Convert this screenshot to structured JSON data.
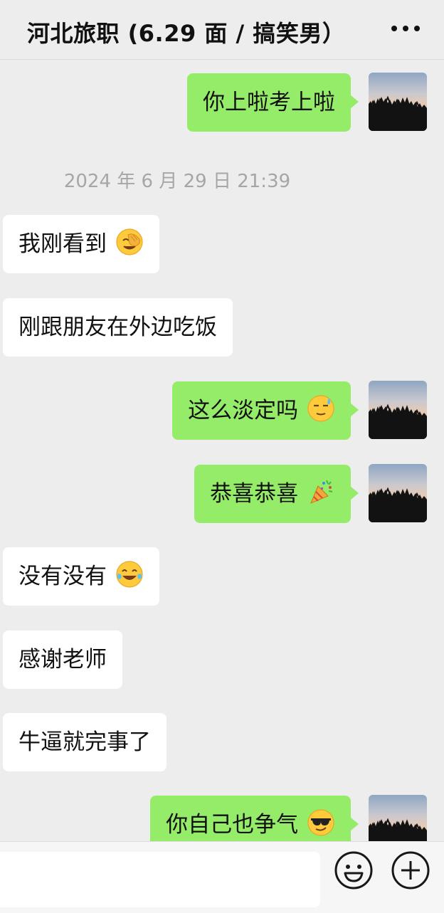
{
  "header": {
    "title": "河北旅职 (6.29 面 / 搞笑男）",
    "more_icon": "more-dots-icon"
  },
  "messages": [
    {
      "side": "out",
      "text": "你上啦考上啦"
    },
    {
      "type": "timestamp",
      "text": "2024 年 6 月 29 日 21:39"
    },
    {
      "side": "in",
      "text": "我刚看到",
      "emoji": "facepalm-emoji"
    },
    {
      "side": "in",
      "text": "刚跟朋友在外边吃饭"
    },
    {
      "side": "out",
      "text": "这么淡定吗",
      "emoji": "sweat-smile-emoji"
    },
    {
      "side": "out",
      "text": "恭喜恭喜",
      "emoji": "party-popper-emoji"
    },
    {
      "side": "in",
      "text": "没有没有",
      "emoji": "tears-of-joy-emoji"
    },
    {
      "side": "in",
      "text": "感谢老师"
    },
    {
      "side": "in",
      "text": "牛逼就完事了"
    },
    {
      "side": "out",
      "text": "你自己也争气",
      "emoji": "sunglasses-emoji"
    }
  ],
  "input_bar": {
    "text_value": "",
    "emoji_icon": "emoji-face-icon",
    "plus_icon": "plus-icon"
  },
  "colors": {
    "background": "#ededed",
    "outgoing_bubble": "#95ec69",
    "incoming_bubble": "#ffffff",
    "timestamp_text": "#a6a6a6"
  }
}
